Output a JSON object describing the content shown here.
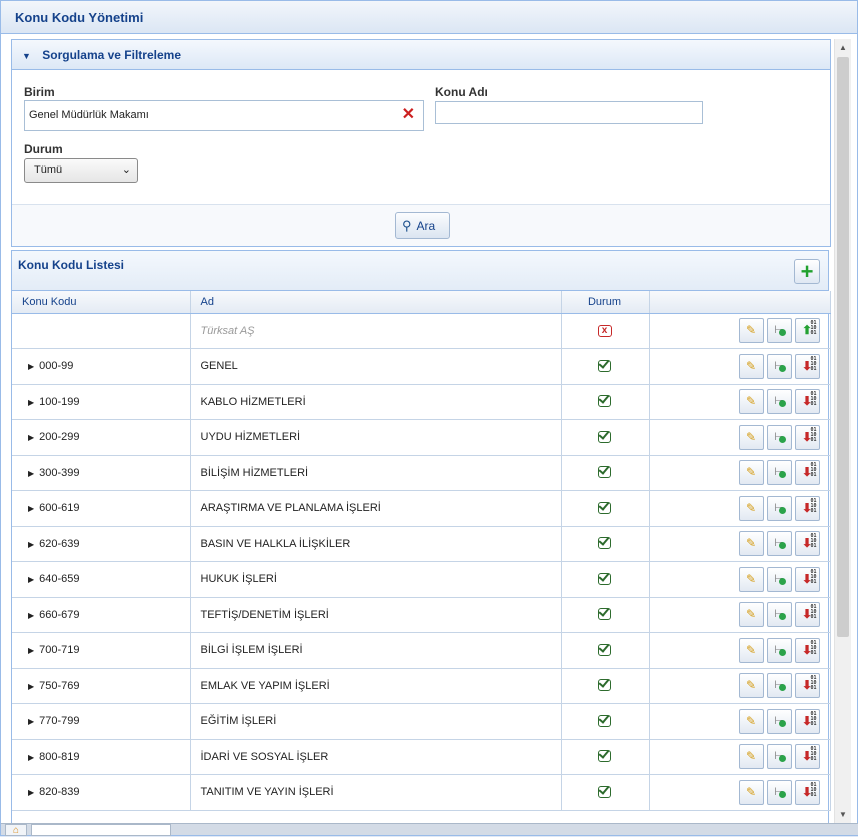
{
  "window": {
    "title": "Konu Kodu Yönetimi"
  },
  "filter": {
    "title": "Sorgulama ve Filtreleme",
    "birim_label": "Birim",
    "birim_value": "Genel Müdürlük Makamı",
    "konu_adi_label": "Konu Adı",
    "konu_adi_value": "",
    "durum_label": "Durum",
    "durum_value": "Tümü",
    "search_label": "Ara"
  },
  "list": {
    "title": "Konu Kodu Listesi",
    "columns": {
      "code": "Konu Kodu",
      "name": "Ad",
      "status": "Durum"
    },
    "root_row": {
      "code": "",
      "name": "Türksat AŞ",
      "status": "passive"
    },
    "rows": [
      {
        "code": "000-99",
        "name": "GENEL",
        "status": "active"
      },
      {
        "code": "100-199",
        "name": "KABLO HİZMETLERİ",
        "status": "active"
      },
      {
        "code": "200-299",
        "name": "UYDU HİZMETLERİ",
        "status": "active"
      },
      {
        "code": "300-399",
        "name": "BİLİŞİM HİZMETLERİ",
        "status": "active"
      },
      {
        "code": "600-619",
        "name": "ARAŞTIRMA VE PLANLAMA İŞLERİ",
        "status": "active"
      },
      {
        "code": "620-639",
        "name": "BASIN VE HALKLA İLİŞKİLER",
        "status": "active"
      },
      {
        "code": "640-659",
        "name": "HUKUK İŞLERİ",
        "status": "active"
      },
      {
        "code": "660-679",
        "name": "TEFTİŞ/DENETİM İŞLERİ",
        "status": "active"
      },
      {
        "code": "700-719",
        "name": "BİLGİ İŞLEM İŞLERİ",
        "status": "active"
      },
      {
        "code": "750-769",
        "name": "EMLAK VE YAPIM İŞLERİ",
        "status": "active"
      },
      {
        "code": "770-799",
        "name": "EĞİTİM İŞLERİ",
        "status": "active"
      },
      {
        "code": "800-819",
        "name": "İDARİ VE SOSYAL İŞLER",
        "status": "active"
      },
      {
        "code": "820-839",
        "name": "TANITIM VE YAYIN İŞLERİ",
        "status": "active"
      }
    ]
  },
  "icons": {
    "add": "plus-icon",
    "edit": "pencil-icon",
    "tree": "tree-icon",
    "export": "arrow-down-icon",
    "export_up": "arrow-up-icon"
  },
  "colors": {
    "accent": "#15428b",
    "border": "#99bbe8",
    "active": "#2d6b2d",
    "passive": "#c62828"
  }
}
